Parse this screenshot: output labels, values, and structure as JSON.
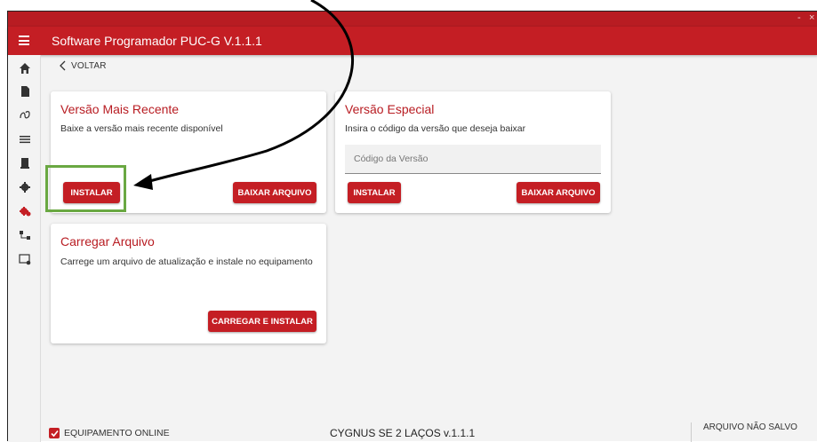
{
  "window": {
    "minimize": "-",
    "close": "×"
  },
  "appbar": {
    "title": "Software Programador PUC-G V.1.1.1",
    "menu_icon": "hamburger-menu-icon"
  },
  "sidebar": {
    "items": [
      {
        "icon": "home-icon"
      },
      {
        "icon": "file-icon"
      },
      {
        "icon": "loop-icon"
      },
      {
        "icon": "list-icon"
      },
      {
        "icon": "document-icon"
      },
      {
        "icon": "settings-gear-icon"
      },
      {
        "icon": "firmware-update-icon",
        "active": true
      },
      {
        "icon": "network-nodes-icon"
      },
      {
        "icon": "window-settings-icon"
      }
    ]
  },
  "back": {
    "label": "VOLTAR"
  },
  "cards": {
    "recent": {
      "title": "Versão Mais Recente",
      "description": "Baixe a versão mais recente disponível",
      "install_label": "INSTALAR",
      "download_label": "BAIXAR ARQUIVO"
    },
    "special": {
      "title": "Versão Especial",
      "description": "Insira o código da versão que deseja baixar",
      "code_placeholder": "Código da Versão",
      "code_value": "",
      "install_label": "INSTALAR",
      "download_label": "BAIXAR ARQUIVO"
    },
    "upload": {
      "title": "Carregar Arquivo",
      "description": "Carrege um arquivo de atualização e instale no equipamento",
      "load_install_label": "CARREGAR E INSTALAR"
    }
  },
  "status": {
    "online_label": "EQUIPAMENTO ONLINE",
    "online_checked": true,
    "device": "CYGNUS SE 2 LAÇOS v.1.1.1",
    "file_state": "ARQUIVO NÃO SALVO"
  },
  "colors": {
    "primary": "#c41e24",
    "titlebar": "#b81c22",
    "highlight": "#6aa842"
  }
}
